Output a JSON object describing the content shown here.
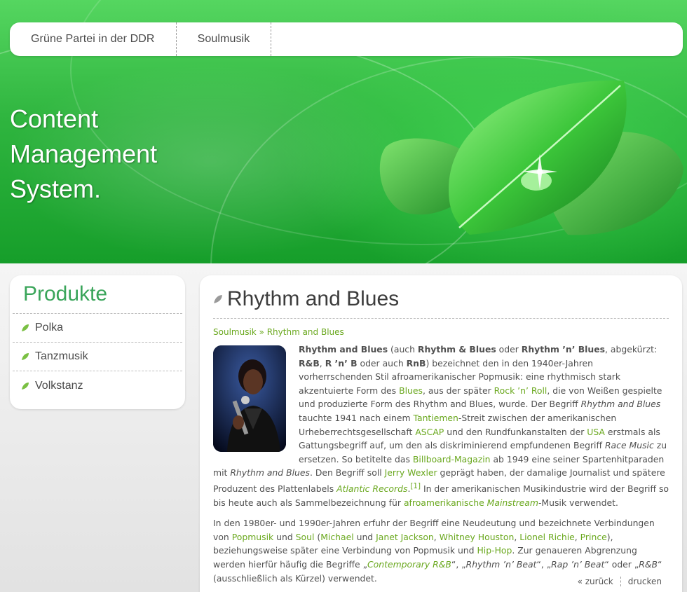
{
  "colors": {
    "accent": "#3aa55a",
    "link": "#6aa81e",
    "header_green": "#2fb53f"
  },
  "nav": {
    "items": [
      {
        "label": "Grüne Partei in der DDR"
      },
      {
        "label": "Soulmusik"
      }
    ]
  },
  "header": {
    "title_lines": [
      "Content",
      "Management",
      "System."
    ]
  },
  "sidebar": {
    "title": "Produkte",
    "items": [
      {
        "label": "Polka"
      },
      {
        "label": "Tanzmusik"
      },
      {
        "label": "Volkstanz"
      }
    ]
  },
  "main": {
    "title": "Rhythm and Blues",
    "breadcrumb": {
      "parent": "Soulmusik",
      "sep": " » ",
      "current": "Rhythm and Blues"
    },
    "p1": {
      "b1": "Rhythm and Blues",
      "t1": " (auch ",
      "b2": "Rhythm & Blues",
      "t2": " oder ",
      "b3": "Rhythm ’n’ Blues",
      "t3": ", abgekürzt: ",
      "b4": "R&B",
      "t4": ", ",
      "b5": "R ’n’ B",
      "t5": " oder auch ",
      "b6": "RnB",
      "t6": ") bezeichnet den in den 1940er-Jahren vorherrschenden Stil afroamerikanischer Popmusik: eine rhythmisch stark akzentuierte Form des ",
      "l1": "Blues",
      "t7": ", aus der später ",
      "l2": "Rock ’n’ Roll",
      "t8": ", die von Weißen gespielte und produzierte Form des Rhythm and Blues, wurde. Der Begriff ",
      "i1": "Rhythm and Blues",
      "t9": " tauchte 1941 nach einem ",
      "l3": "Tantiemen",
      "t10": "-Streit zwischen der amerikanischen Urheberrechtsgesellschaft ",
      "l4": "ASCAP",
      "t11": " und den Rundfunkanstalten der ",
      "l5": "USA",
      "t12": " erstmals als Gattungsbegriff auf, um den als diskriminierend empfundenen Begriff ",
      "i2": "Race Music",
      "t13": " zu ersetzen. So betitelte das ",
      "l6": "Billboard-Magazin",
      "t14": " ab 1949 eine seiner Spartenhitparaden mit ",
      "i3": "Rhythm and Blues",
      "t15": ". Den Begriff soll ",
      "l7": "Jerry Wexler",
      "t16": " geprägt haben, der damalige Journalist und spätere Produzent des Plattenlabels ",
      "l8": "Atlantic Records",
      "t17": ".",
      "l9": "[1]",
      "t18": " In der amerikanischen Musikindustrie wird der Begriff so bis heute auch als Sammelbezeichnung für ",
      "l10": "afroamerikanische",
      "t19": " ",
      "l11": "Mainstream",
      "t20": "-Musik verwendet."
    },
    "p2": {
      "t1": "In den 1980er- und 1990er-Jahren erfuhr der Begriff eine Neudeutung und bezeichnete Verbindungen von ",
      "l1": "Popmusik",
      "t2": " und ",
      "l2": "Soul",
      "t3": " (",
      "l3": "Michael",
      "t4": " und ",
      "l4": "Janet Jackson",
      "t5": ", ",
      "l5": "Whitney Houston",
      "t6": ", ",
      "l6": "Lionel Richie",
      "t7": ", ",
      "l7": "Prince",
      "t8": "), beziehungsweise später eine Verbindung von Popmusik und ",
      "l8": "Hip-Hop",
      "t9": ". Zur genaueren Abgrenzung werden hierfür häufig die Begriffe „",
      "l9": "Contemporary R&B",
      "t10": "“, „",
      "i1": "Rhythm ’n’ Beat",
      "t11": "“, „",
      "i2": "Rap ’n’ Beat",
      "t12": "“ oder „",
      "i3": "R&B",
      "t13": "“ (ausschließlich als Kürzel) verwendet."
    },
    "back_label": "« zurück",
    "print_label": "drucken"
  }
}
